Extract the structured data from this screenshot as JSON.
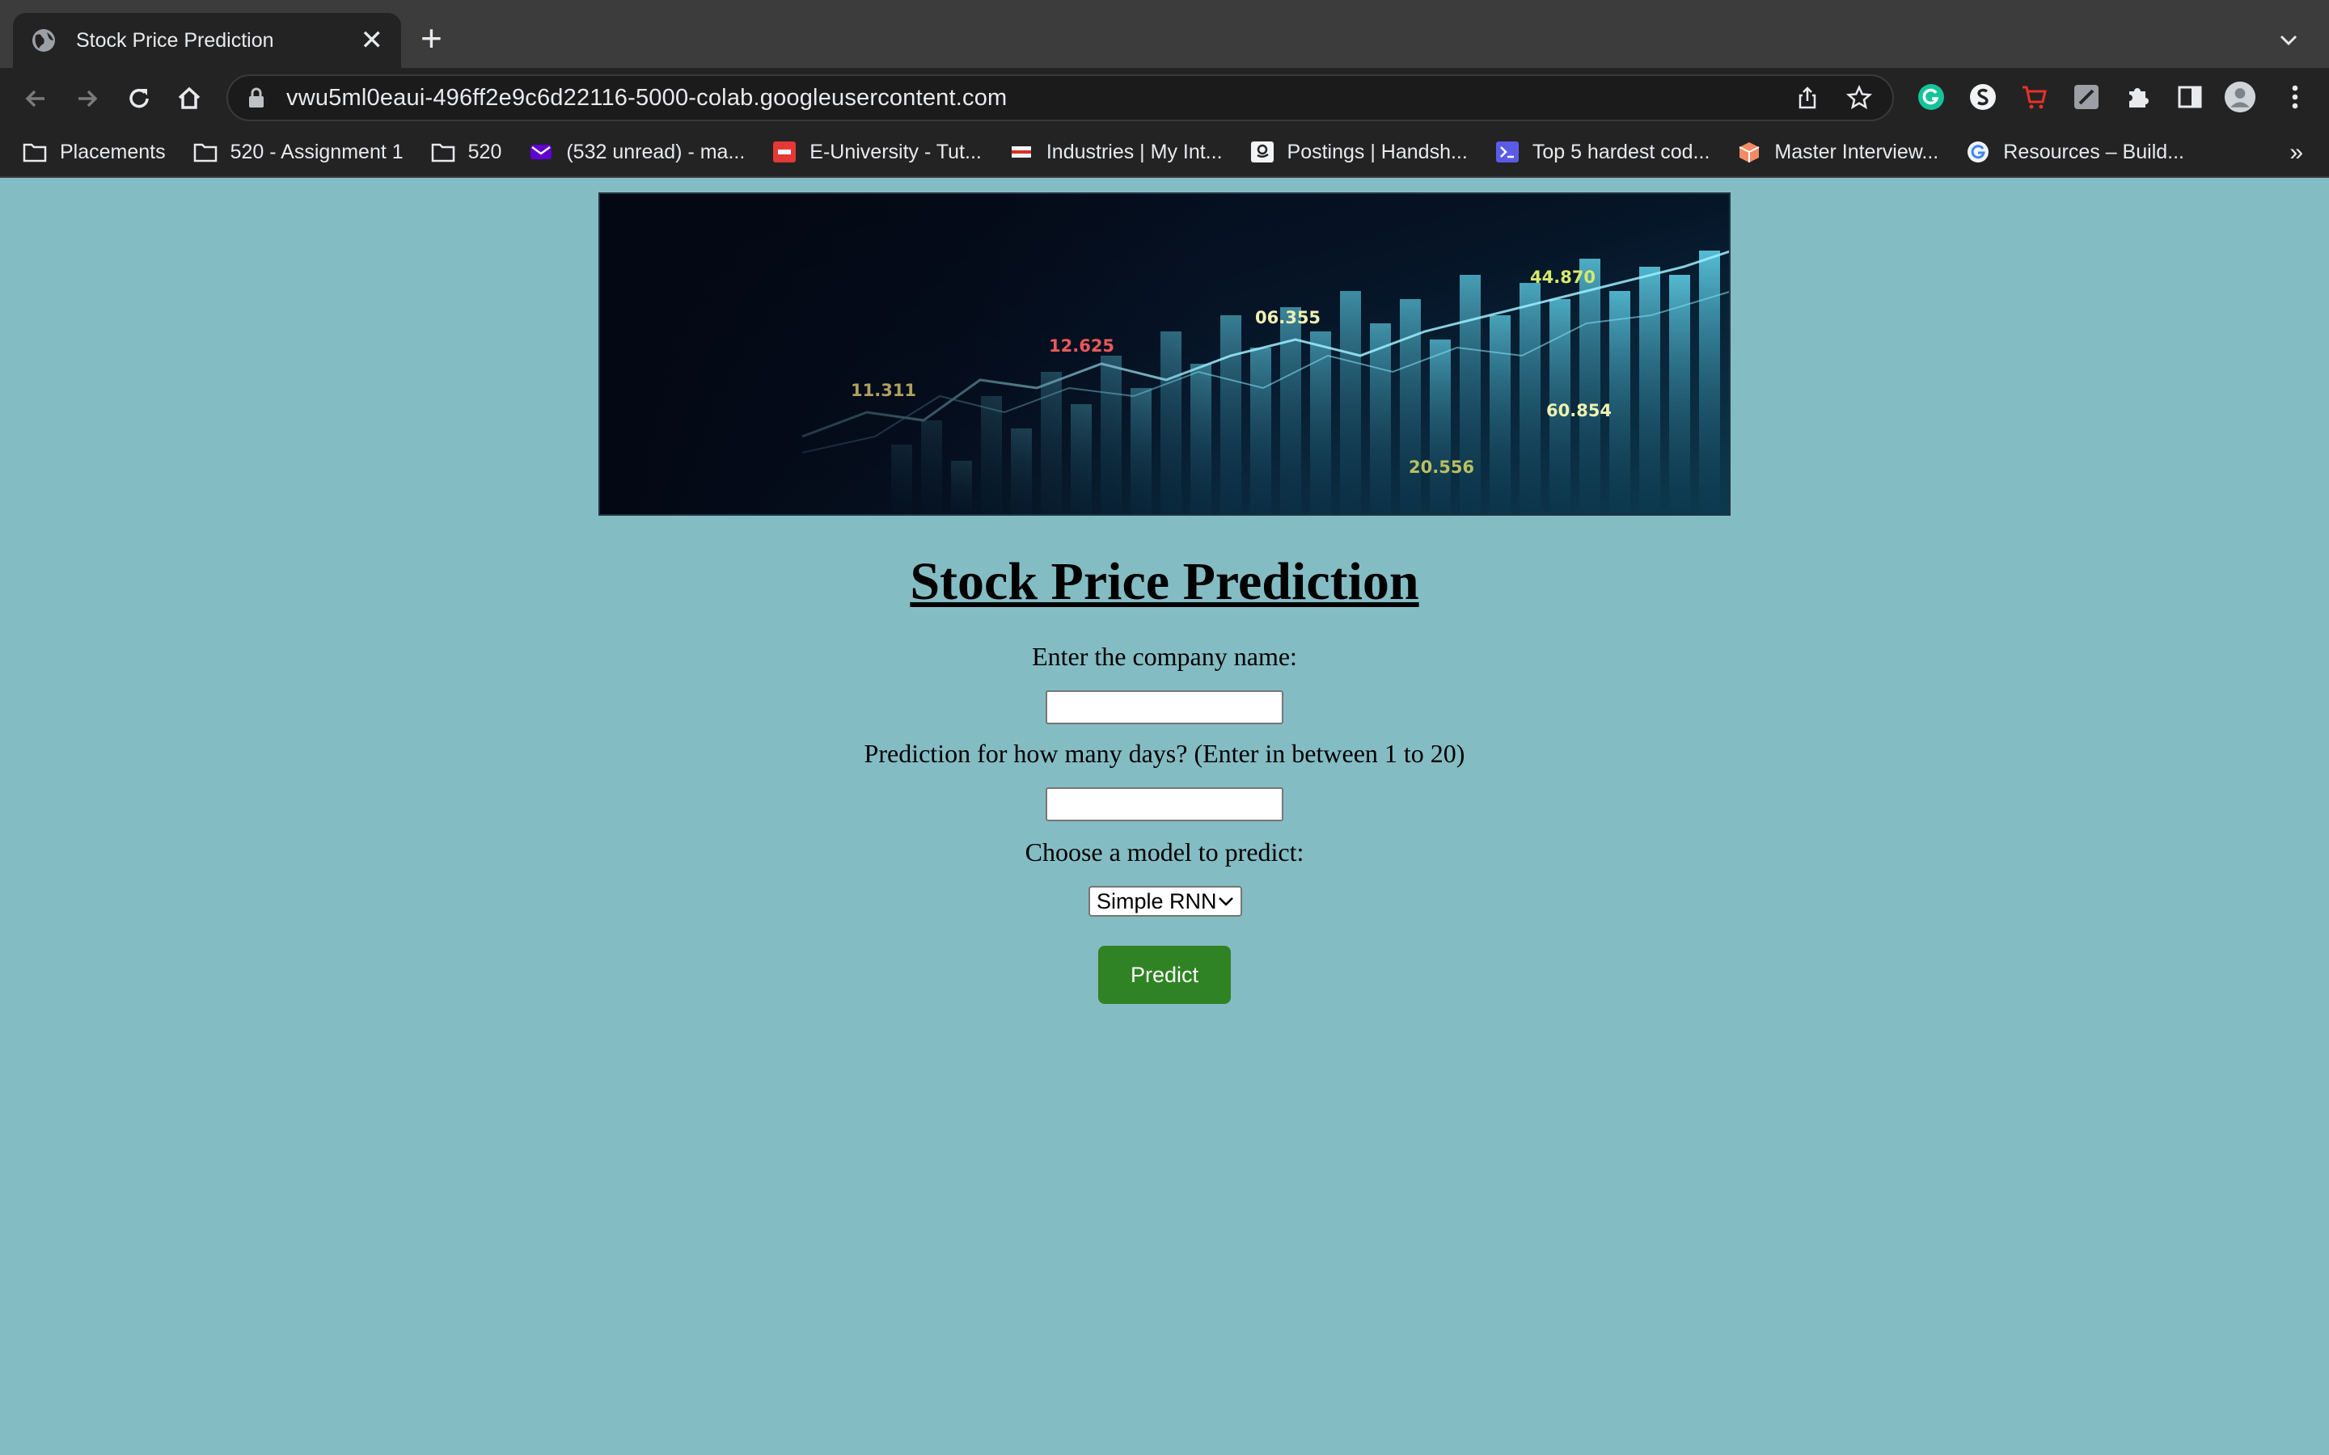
{
  "browser": {
    "tab_title": "Stock Price Prediction",
    "close_glyph": "✕",
    "new_tab_glyph": "+",
    "url": "vwu5ml0eaui-496ff2e9c6d22116-5000-colab.googleusercontent.com",
    "bookmarks": [
      {
        "label": "Placements",
        "icon": "folder-icon"
      },
      {
        "label": "520 - Assignment 1",
        "icon": "folder-icon"
      },
      {
        "label": "520",
        "icon": "folder-icon"
      },
      {
        "label": "(532 unread) - ma...",
        "icon": "yahoo-mail-icon"
      },
      {
        "label": "E-University - Tut...",
        "icon": "job-icon"
      },
      {
        "label": "Industries | My Int...",
        "icon": "flag-icon"
      },
      {
        "label": "Postings | Handsh...",
        "icon": "amazon-icon"
      },
      {
        "label": "Top 5 hardest cod...",
        "icon": "terminal-icon"
      },
      {
        "label": "Master Interview...",
        "icon": "box-icon"
      },
      {
        "label": "Resources – Build...",
        "icon": "google-icon"
      }
    ],
    "more_glyph": "»",
    "accent_colors": {
      "tab_bar": "#3c3c3c",
      "toolbar": "#232323",
      "page_bg": "#84bcc4",
      "button": "#2f8324"
    }
  },
  "banner": {
    "numbers": [
      "44.870",
      "06.355",
      "12.625",
      "11.311",
      "60.854",
      "20.556"
    ]
  },
  "form": {
    "title": "Stock Price Prediction",
    "company_label": "Enter the company name:",
    "company_value": "",
    "days_label": "Prediction for how many days? (Enter in between 1 to 20)",
    "days_value": "",
    "model_label": "Choose a model to predict:",
    "model_selected": "Simple RNN",
    "predict_label": "Predict"
  }
}
